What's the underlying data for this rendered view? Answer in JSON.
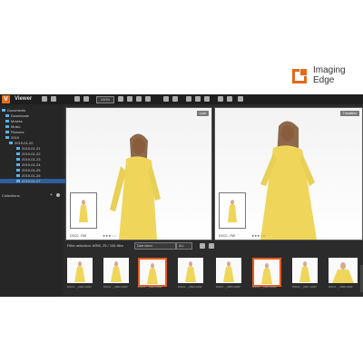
{
  "brand": {
    "line1": "Imaging",
    "line2": "Edge",
    "accent": "#e26a1b"
  },
  "app": {
    "title": "Viewer",
    "zoom": "100%",
    "tree": [
      "Documents",
      "Downloads",
      "Movies",
      "Music",
      "Pictures",
      "2019",
      "2019-01-20",
      "2019-01-21",
      "2019-01-22",
      "2019-01-23",
      "2019-01-24",
      "2019-01-25",
      "2019-01-26",
      "2019-01-27"
    ],
    "collections_label": "Collections",
    "left_pane": {
      "badge": "Lock",
      "label": "DSC0...RW",
      "stars": "★★★☆☆"
    },
    "right_pane": {
      "badge": "Transition",
      "label": "DSC0...RW",
      "stars": "★★★☆☆"
    },
    "filter": {
      "text": "Filter selection: ARW, 25 / 106 files",
      "sort": "Date taken",
      "rating": "ALL"
    },
    "thumbnails": [
      {
        "name": "DSC0..._0001.ARW"
      },
      {
        "name": "DSC0..._0002.ARW"
      },
      {
        "name": "DSC0..._0003.ARW"
      },
      {
        "name": "DSC0..._0004.ARW"
      },
      {
        "name": "DSC0..._0005.ARW"
      },
      {
        "name": "DSC0..._0006.ARW"
      },
      {
        "name": "DSC0..._0007.ARW"
      },
      {
        "name": "DSC0..._0008.ARW"
      }
    ]
  }
}
